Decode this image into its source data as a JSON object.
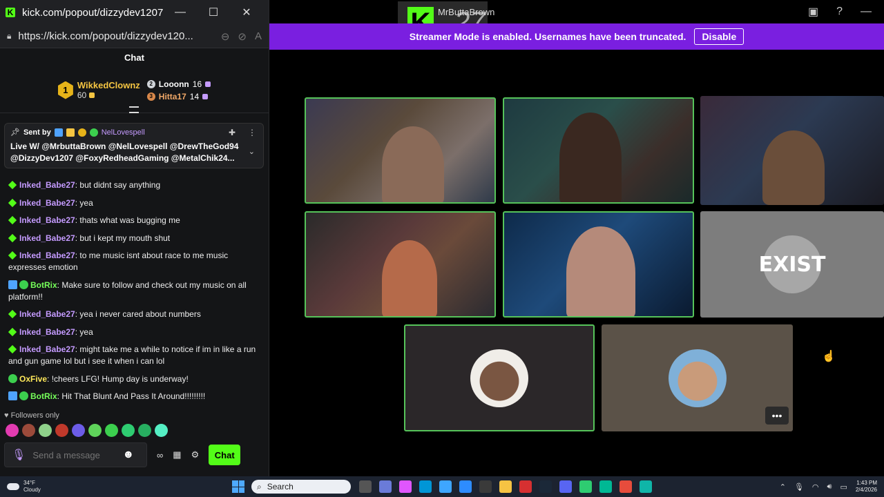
{
  "popout": {
    "title": "kick.com/popout/dizzydev1207...",
    "url": "https://kick.com/popout/dizzydev120...",
    "chat_header": "Chat"
  },
  "leaderboard": {
    "first": {
      "rank": "1",
      "name": "WikkedClownz",
      "points": "60"
    },
    "second": {
      "name": "Looonn",
      "points": "16"
    },
    "third": {
      "name": "Hitta17",
      "points": "14"
    }
  },
  "pinned": {
    "sent_by_label": "Sent by",
    "sender": "NelLovespell",
    "text": "Live W/ @MrbuttaBrown @NelLovespell @DrewTheGod94 @DizzyDev1207 @FoxyRedheadGaming @MetalChik24..."
  },
  "messages": [
    {
      "user": "Inked_Babe27",
      "text": "but didnt say anything",
      "color": "#c59bff",
      "badge": "gem"
    },
    {
      "user": "Inked_Babe27",
      "text": "yea",
      "color": "#c59bff",
      "badge": "gem"
    },
    {
      "user": "Inked_Babe27",
      "text": "thats what was bugging me",
      "color": "#c59bff",
      "badge": "gem"
    },
    {
      "user": "Inked_Babe27",
      "text": "but i kept my mouth shut",
      "color": "#c59bff",
      "badge": "gem"
    },
    {
      "user": "Inked_Babe27",
      "text": "to me music isnt about race to me music expresses emotion",
      "color": "#c59bff",
      "badge": "gem"
    },
    {
      "user": "BotRix",
      "text": "Make sure to follow and check out my music on all platform!!",
      "color": "#76ff5a",
      "badge": "bot"
    },
    {
      "user": "Inked_Babe27",
      "text": "yea i never cared about numbers",
      "color": "#c59bff",
      "badge": "gem"
    },
    {
      "user": "Inked_Babe27",
      "text": "yea",
      "color": "#c59bff",
      "badge": "gem"
    },
    {
      "user": "Inked_Babe27",
      "text": "might take me a while to notice if im in like a run and gun game lol but i see it when i can lol",
      "color": "#c59bff",
      "badge": "gem"
    },
    {
      "user": "OxFive",
      "text": "!cheers LFG! Hump day is underway!",
      "color": "#ffe95a",
      "badge": "ver"
    },
    {
      "user": "BotRix",
      "text": "Hit That Blunt And Pass It Around!!!!!!!!!",
      "color": "#76ff5a",
      "badge": "bot"
    }
  ],
  "chat_footer": {
    "followers_only": "Followers only",
    "input_placeholder": "Send a message",
    "chat_button": "Chat"
  },
  "stage": {
    "overlay_name": "MrButtaBrown",
    "overlay_number": "27",
    "banner_text": "Streamer Mode is enabled. Usernames have been truncated.",
    "disable_button": "Disable",
    "exist_text": "EXIST"
  },
  "taskbar": {
    "temp": "34°F",
    "condition": "Cloudy",
    "search": "Search",
    "time": "1:43 PM",
    "date": "2/4/2026"
  },
  "colors": {
    "kick_green": "#53fc18",
    "banner_purple": "#7a1fe0",
    "active_border": "#56c45a"
  }
}
